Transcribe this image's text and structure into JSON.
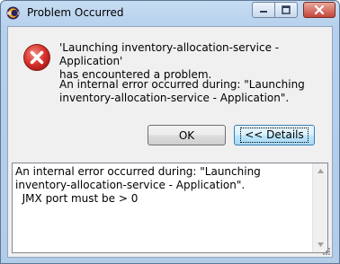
{
  "window": {
    "title": "Problem Occurred",
    "icon": "eclipse-icon",
    "controls": [
      "minimize-icon",
      "maximize-icon",
      "close-icon"
    ]
  },
  "dialog": {
    "icon": "error-icon",
    "message_line1": "'Launching inventory-allocation-service - Application'\nhas encountered a problem.",
    "message_line2": "An internal error occurred during: \"Launching\ninventory-allocation-service - Application\"."
  },
  "buttons": {
    "ok_label": "OK",
    "details_label": "<< Details"
  },
  "details": {
    "text": "An internal error occurred during: \"Launching\ninventory-allocation-service - Application\".\n  JMX port must be > 0"
  },
  "colors": {
    "error_red": "#d7312b",
    "title_bar": "#b9d1ea",
    "content_bg": "#f0f0f0"
  }
}
